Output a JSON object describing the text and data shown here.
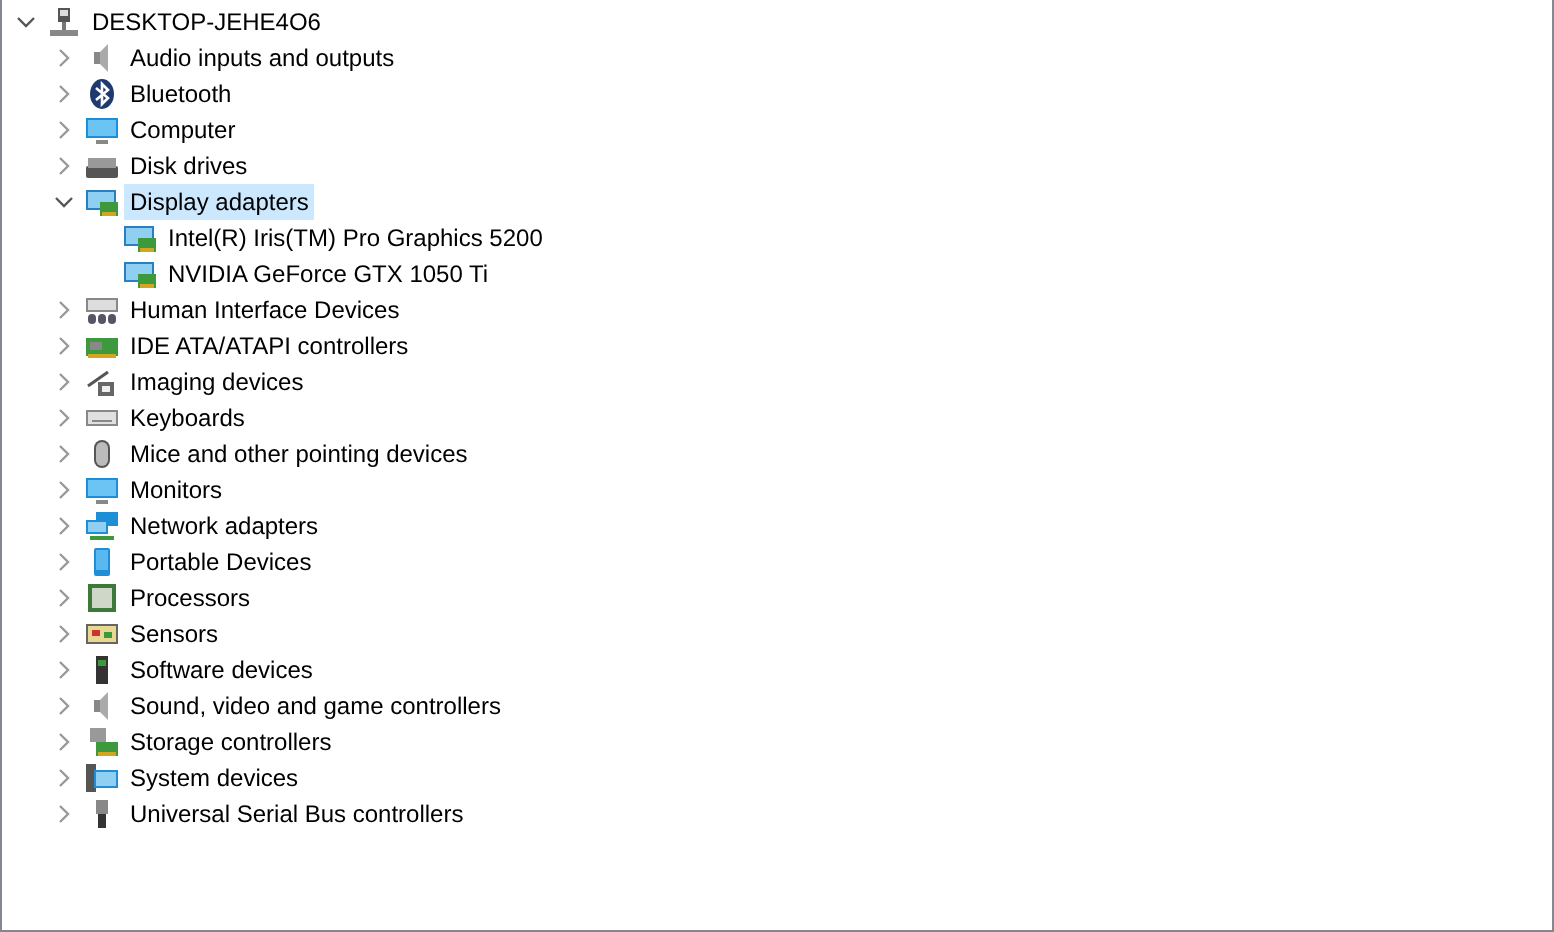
{
  "tree": {
    "label": "DESKTOP-JEHE4O6",
    "kind": "computer",
    "expanded": true,
    "selected": false,
    "children": [
      {
        "label": "Audio inputs and outputs",
        "kind": "speaker",
        "expanded": false,
        "selected": false
      },
      {
        "label": "Bluetooth",
        "kind": "bluetooth",
        "expanded": false,
        "selected": false
      },
      {
        "label": "Computer",
        "kind": "monitor",
        "expanded": false,
        "selected": false
      },
      {
        "label": "Disk drives",
        "kind": "disk",
        "expanded": false,
        "selected": false
      },
      {
        "label": "Display adapters",
        "kind": "adapter",
        "expanded": true,
        "selected": true,
        "children": [
          {
            "label": "Intel(R) Iris(TM) Pro Graphics 5200",
            "kind": "adapter",
            "selected": false
          },
          {
            "label": "NVIDIA GeForce GTX 1050 Ti",
            "kind": "adapter",
            "selected": false
          }
        ]
      },
      {
        "label": "Human Interface Devices",
        "kind": "hid",
        "expanded": false,
        "selected": false
      },
      {
        "label": "IDE ATA/ATAPI controllers",
        "kind": "board",
        "expanded": false,
        "selected": false
      },
      {
        "label": "Imaging devices",
        "kind": "camera",
        "expanded": false,
        "selected": false
      },
      {
        "label": "Keyboards",
        "kind": "keyboard",
        "expanded": false,
        "selected": false
      },
      {
        "label": "Mice and other pointing devices",
        "kind": "mouse",
        "expanded": false,
        "selected": false
      },
      {
        "label": "Monitors",
        "kind": "monitor",
        "expanded": false,
        "selected": false
      },
      {
        "label": "Network adapters",
        "kind": "network",
        "expanded": false,
        "selected": false
      },
      {
        "label": "Portable Devices",
        "kind": "portable",
        "expanded": false,
        "selected": false
      },
      {
        "label": "Processors",
        "kind": "chip",
        "expanded": false,
        "selected": false
      },
      {
        "label": "Sensors",
        "kind": "sensor",
        "expanded": false,
        "selected": false
      },
      {
        "label": "Software devices",
        "kind": "tower",
        "expanded": false,
        "selected": false
      },
      {
        "label": "Sound, video and game controllers",
        "kind": "speaker",
        "expanded": false,
        "selected": false
      },
      {
        "label": "Storage controllers",
        "kind": "storage",
        "expanded": false,
        "selected": false
      },
      {
        "label": "System devices",
        "kind": "system",
        "expanded": false,
        "selected": false
      },
      {
        "label": "Universal Serial Bus controllers",
        "kind": "usb",
        "expanded": false,
        "selected": false
      }
    ]
  }
}
